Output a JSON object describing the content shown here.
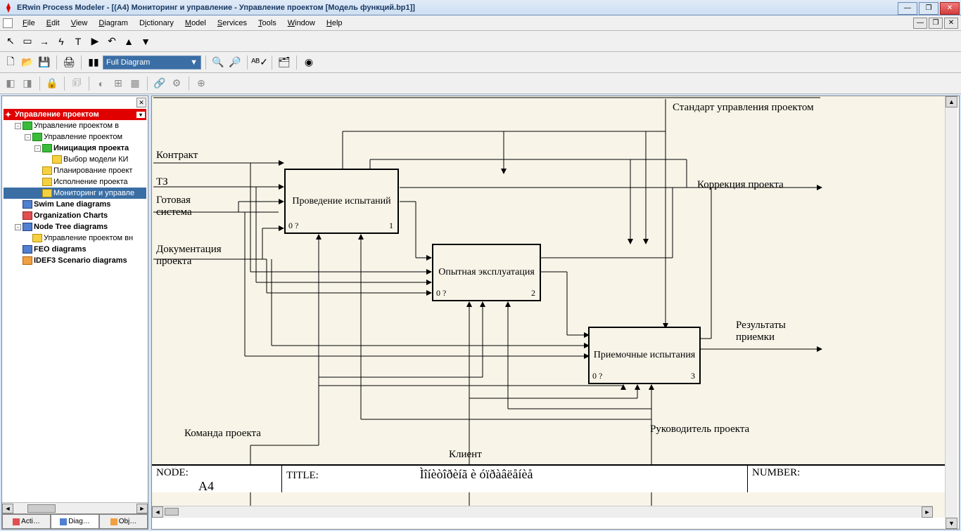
{
  "titlebar": "ERwin Process Modeler - [(A4) Мониторинг и управление - Управление проектом  [Модель функций.bp1]]",
  "menus": [
    "File",
    "Edit",
    "View",
    "Diagram",
    "Dictionary",
    "Model",
    "Services",
    "Tools",
    "Window",
    "Help"
  ],
  "zoomcombo": "Full Diagram",
  "tree": {
    "root": "Управление проектом",
    "items": [
      {
        "indent": 1,
        "icon": "green",
        "sq": "-",
        "label": "Управление проектом в"
      },
      {
        "indent": 2,
        "icon": "green",
        "sq": "-",
        "label": "Управление проектом"
      },
      {
        "indent": 3,
        "icon": "green",
        "sq": "-",
        "bold": true,
        "label": "Инициация проекта"
      },
      {
        "indent": 4,
        "icon": "yellow",
        "sq": "",
        "label": "Выбор модели  КИ"
      },
      {
        "indent": 3,
        "icon": "yellow",
        "sq": "",
        "label": "Планирование проект"
      },
      {
        "indent": 3,
        "icon": "yellow",
        "sq": "",
        "label": "Исполнение проекта"
      },
      {
        "indent": 3,
        "icon": "yellow",
        "sq": "",
        "sel": true,
        "label": "Мониторинг и управле"
      },
      {
        "indent": 1,
        "icon": "blue",
        "sq": "",
        "bold": true,
        "label": "Swim Lane diagrams"
      },
      {
        "indent": 1,
        "icon": "red",
        "sq": "",
        "bold": true,
        "label": "Organization Charts"
      },
      {
        "indent": 1,
        "icon": "blue",
        "sq": "-",
        "bold": true,
        "label": "Node Tree diagrams"
      },
      {
        "indent": 2,
        "icon": "yellow",
        "sq": "",
        "label": "Управление проектом вн"
      },
      {
        "indent": 1,
        "icon": "blue",
        "sq": "",
        "bold": true,
        "label": "FEO diagrams"
      },
      {
        "indent": 1,
        "icon": "orange",
        "sq": "",
        "bold": true,
        "label": "IDEF3 Scenario diagrams"
      }
    ]
  },
  "sidetabs": [
    "Acti…",
    "Diag…",
    "Obj…"
  ],
  "diagram": {
    "top_control": "Стандарт управления проектом",
    "inputs": [
      "Контракт",
      "ТЗ",
      "Готовая система",
      "Документация проекта"
    ],
    "box1": {
      "title": "Проведение испытаний",
      "bl": "0 ?",
      "br": "1"
    },
    "box2": {
      "title": "Опытная эксплуатация",
      "bl": "0 ?",
      "br": "2"
    },
    "box3": {
      "title": "Приемочные испытания",
      "bl": "0 ?",
      "br": "3"
    },
    "out1": "Коррекция проекта",
    "out2": "Результаты приемки",
    "bot1": "Команда проекта",
    "bot2": "Клиент",
    "bot3": "Руководитель проекта",
    "footer": {
      "node": "NODE:",
      "node_v": "A4",
      "title": "TITLE:",
      "title_v": "Ìîíèòîðèíã è óïðàâëåíèå",
      "number": "NUMBER:"
    }
  }
}
